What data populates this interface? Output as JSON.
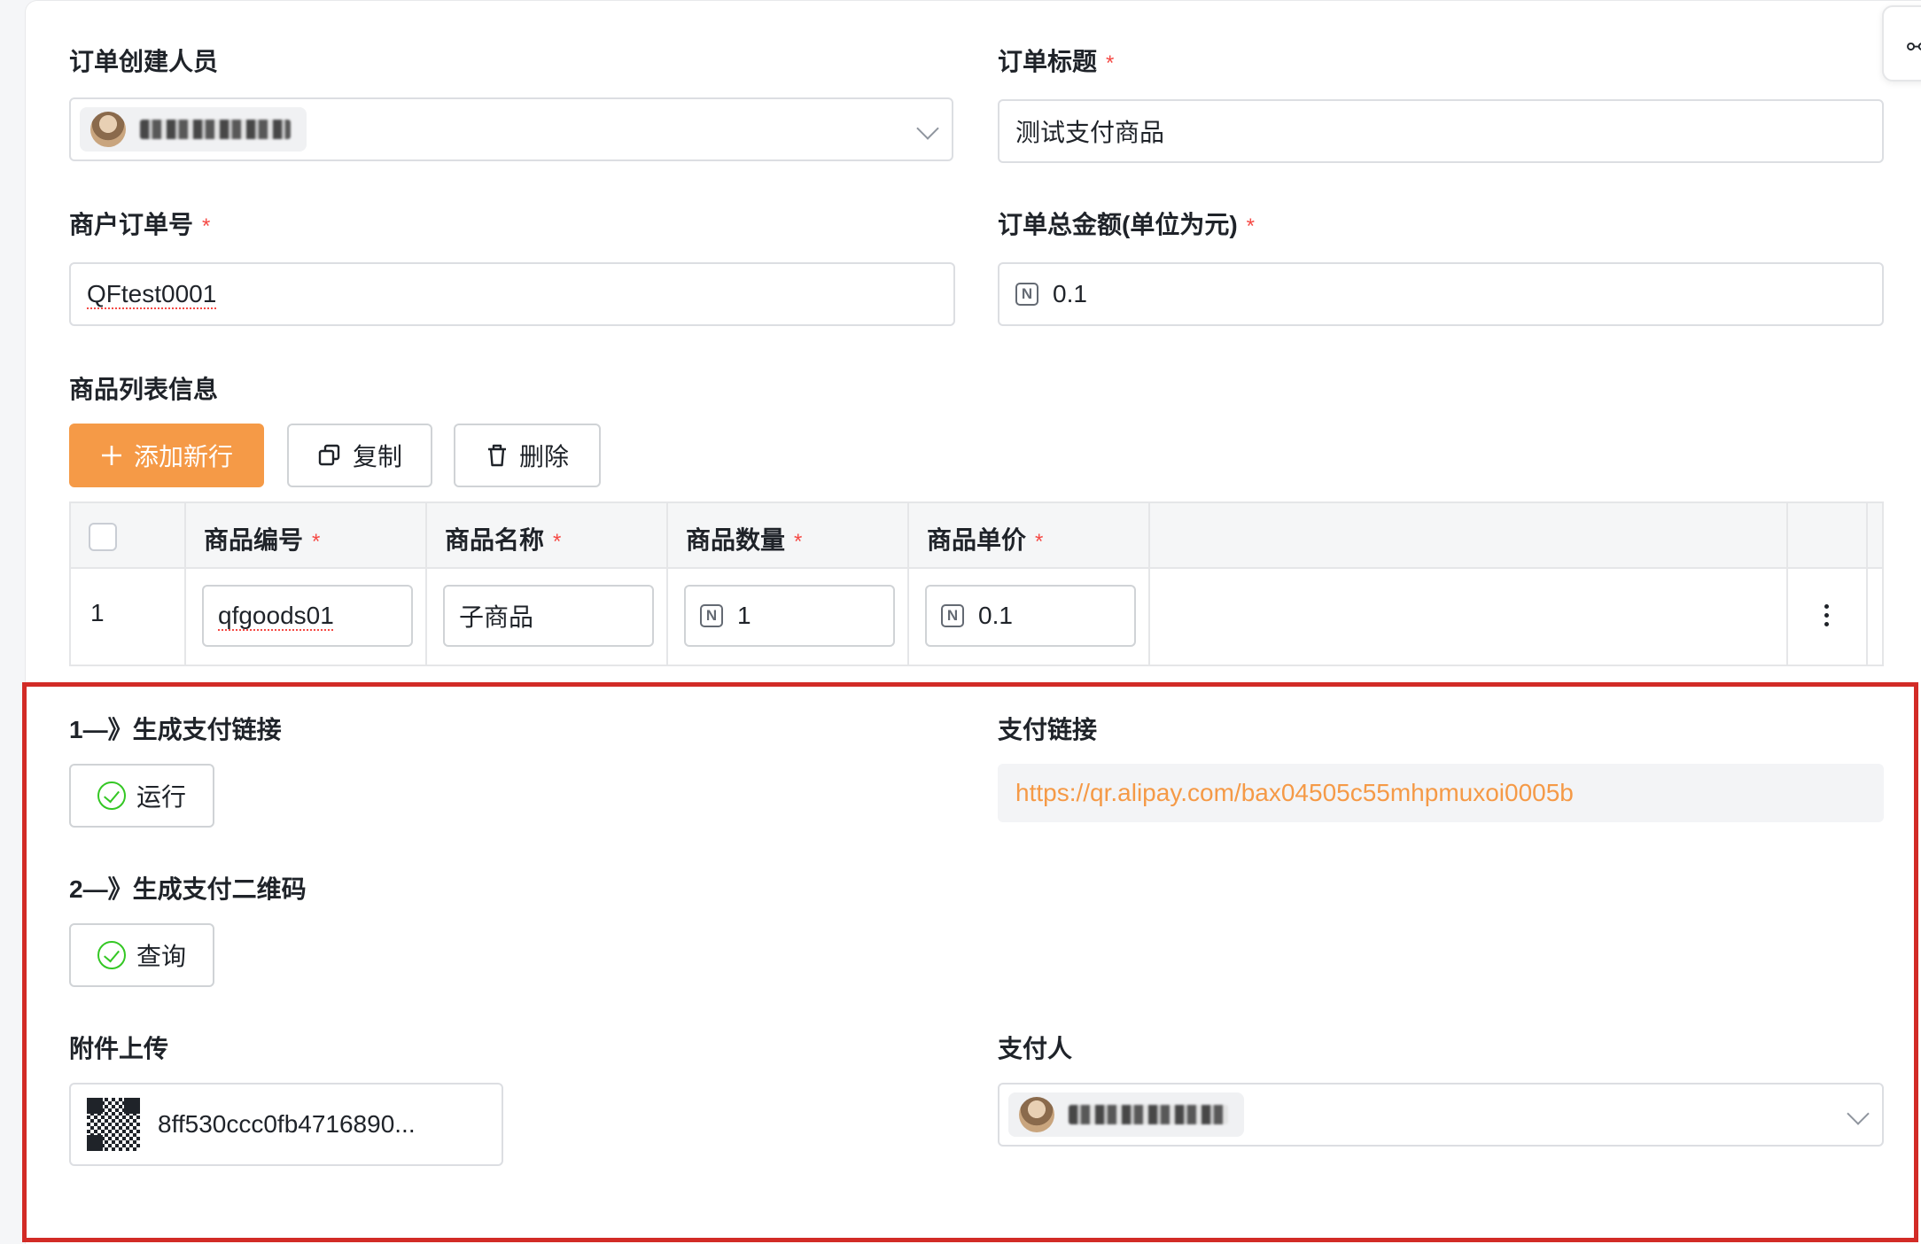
{
  "form": {
    "creator_label": "订单创建人员",
    "title_label": "订单标题",
    "title_value": "测试支付商品",
    "merchant_order_label": "商户订单号",
    "merchant_order_value": "QFtest0001",
    "amount_label": "订单总金额(单位为元)",
    "amount_value": "0.1",
    "goods_section_label": "商品列表信息",
    "required_mark": "*"
  },
  "toolbar": {
    "add_label": "添加新行",
    "copy_label": "复制",
    "delete_label": "删除"
  },
  "table": {
    "columns": [
      "商品编号",
      "商品名称",
      "商品数量",
      "商品单价"
    ],
    "rows": [
      {
        "index": "1",
        "goods_id": "qfgoods01",
        "goods_name": "子商品",
        "quantity": "1",
        "unit_price": "0.1"
      }
    ]
  },
  "actions": {
    "step1_label": "1—》生成支付链接",
    "run_label": "运行",
    "step2_label": "2—》生成支付二维码",
    "query_label": "查询",
    "pay_link_label": "支付链接",
    "pay_link_value": "https://qr.alipay.com/bax04505c55mhpmuxoi0005b",
    "attachment_label": "附件上传",
    "attachment_name": "8ff530ccc0fb4716890...",
    "payer_label": "支付人"
  },
  "icons": {
    "add": "plus-icon",
    "copy": "copy-icon",
    "delete": "trash-icon",
    "number": "number-icon",
    "check": "check-circle-icon",
    "chevron": "chevron-down-icon",
    "more": "more-vertical-icon",
    "link": "link-icon"
  },
  "colors": {
    "accent": "#f59a47",
    "required": "#f54a45",
    "success": "#34c724",
    "highlight_border": "#d22b26"
  }
}
